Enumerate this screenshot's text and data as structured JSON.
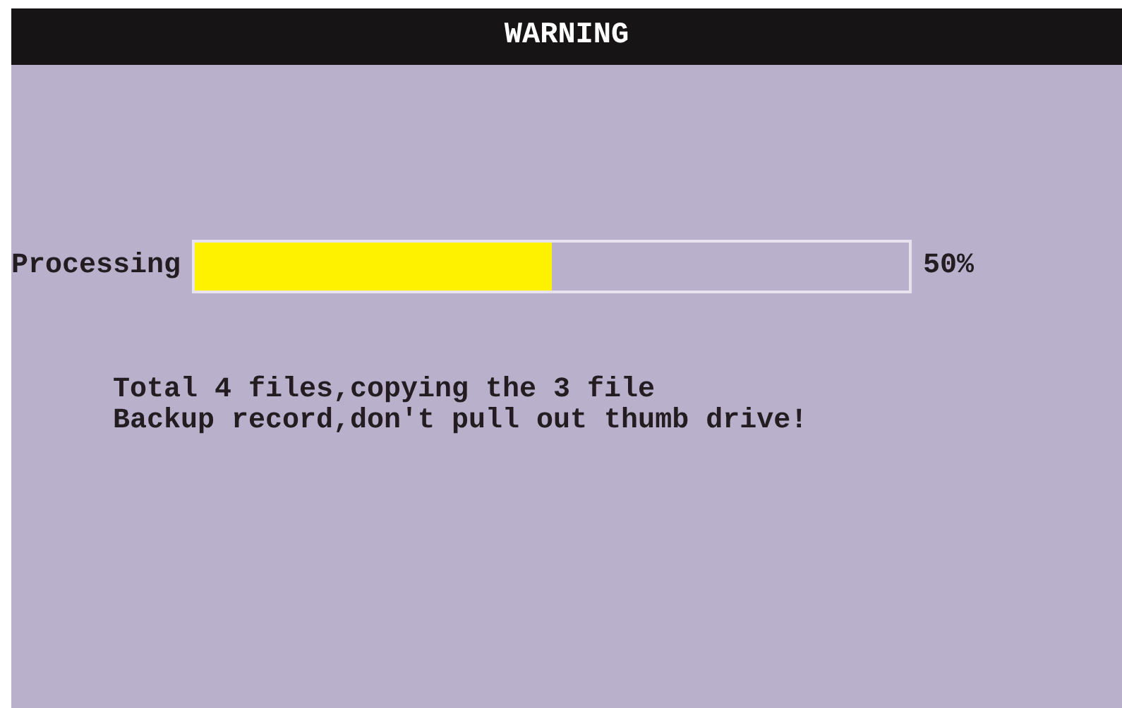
{
  "window": {
    "title": "WARNING"
  },
  "progress": {
    "label": "Processing",
    "level": 0.5,
    "reading": "50%"
  },
  "messages": [
    "Total 4 files,copying the 3 file",
    "Backup record,don't pull out thumb drive!"
  ]
}
